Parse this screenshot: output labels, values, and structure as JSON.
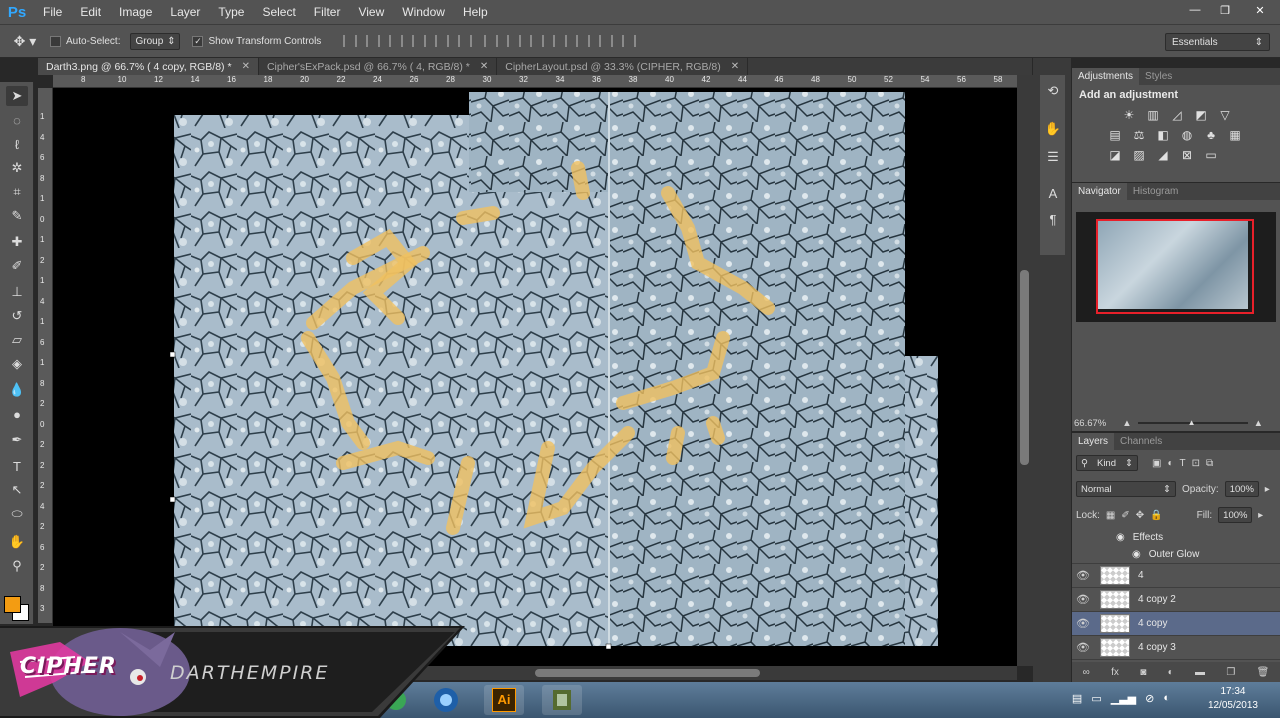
{
  "app": {
    "logo": "Ps"
  },
  "menu": [
    "File",
    "Edit",
    "Image",
    "Layer",
    "Type",
    "Select",
    "Filter",
    "View",
    "Window",
    "Help"
  ],
  "window_controls": {
    "minimize": "—",
    "restore": "❐",
    "close": "✕"
  },
  "options": {
    "auto_select_label": "Auto-Select:",
    "auto_select_checked": false,
    "group_value": "Group",
    "show_transform_label": "Show Transform Controls",
    "show_transform_checked": true,
    "workspace": "Essentials"
  },
  "tabs": [
    {
      "label": "Darth3.png @ 66.7% ( 4 copy, RGB/8) *",
      "active": true
    },
    {
      "label": "Cipher'sExPack.psd @ 66.7% ( 4, RGB/8) *",
      "active": false
    },
    {
      "label": "CipherLayout.psd @ 33.3% (CIPHER, RGB/8)",
      "active": false
    }
  ],
  "ruler_top": [
    "8",
    "10",
    "12",
    "14",
    "16",
    "18",
    "20",
    "22",
    "24",
    "26",
    "28",
    "30",
    "32",
    "34",
    "36",
    "38",
    "40",
    "42",
    "44",
    "46",
    "48",
    "50",
    "52",
    "54",
    "56",
    "58"
  ],
  "ruler_left": [
    "1",
    "4",
    "6",
    "8",
    "1",
    "0",
    "1",
    "2",
    "1",
    "4",
    "1",
    "6",
    "1",
    "8",
    "2",
    "0",
    "2",
    "2",
    "2",
    "4",
    "2",
    "6",
    "2",
    "8",
    "3"
  ],
  "toolbar_icons": [
    "move-tool",
    "marquee-tool",
    "lasso-tool",
    "magic-wand-tool",
    "crop-tool",
    "eyedropper-tool",
    "healing-brush-tool",
    "brush-tool",
    "clone-stamp-tool",
    "history-brush-tool",
    "eraser-tool",
    "paint-bucket-tool",
    "dodge-tool",
    "pen-tool",
    "type-tool",
    "path-selection-tool",
    "ellipse-tool",
    "hand-tool",
    "zoom-tool"
  ],
  "colors": {
    "foreground": "#f39c12",
    "background": "#ffffff",
    "navigator_frame": "#e8202a",
    "selected_layer": "#5b6a8a"
  },
  "adjustments": {
    "tabs": [
      "Adjustments",
      "Styles"
    ],
    "title": "Add an adjustment"
  },
  "navigator": {
    "tabs": [
      "Navigator",
      "Histogram"
    ],
    "zoom": "66.67%"
  },
  "layers_panel": {
    "tabs": [
      "Layers",
      "Channels"
    ],
    "filter_kind": "Kind",
    "blend_mode": "Normal",
    "opacity_label": "Opacity:",
    "opacity_value": "100%",
    "lock_label": "Lock:",
    "fill_label": "Fill:",
    "fill_value": "100%",
    "effects_label": "Effects",
    "effect_item": "Outer Glow",
    "layers": [
      {
        "name": "4",
        "selected": false
      },
      {
        "name": "4 copy 2",
        "selected": false
      },
      {
        "name": "4 copy",
        "selected": true
      },
      {
        "name": "4 copy 3",
        "selected": false
      }
    ],
    "bottom_icons": [
      "link-icon",
      "fx-icon",
      "mask-icon",
      "adjustment-icon",
      "folder-icon",
      "new-layer-icon",
      "trash-icon"
    ],
    "bottom_fx": "fx"
  },
  "banner": {
    "text": "DARTHEMPIRE",
    "logo_text": "CIPHER"
  },
  "taskbar": {
    "time": "17:34",
    "date": "12/05/2013",
    "ai_label": "Ai"
  }
}
